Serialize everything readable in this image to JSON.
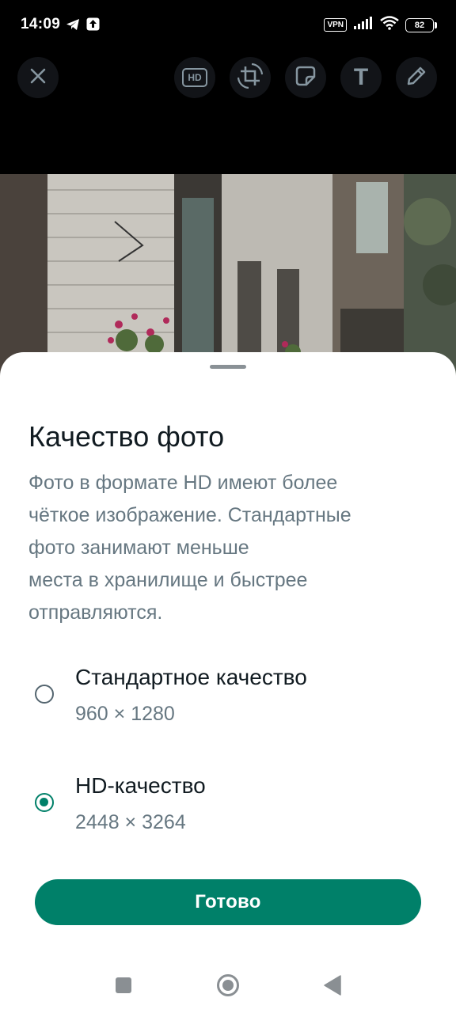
{
  "status_bar": {
    "time": "14:09",
    "vpn": "VPN",
    "battery": "82",
    "icons": [
      "telegram-icon",
      "upload-notification-icon",
      "signal-icon",
      "wifi-icon",
      "battery-icon"
    ]
  },
  "toolbar": {
    "icons": [
      "close-icon",
      "hd-icon",
      "crop-rotate-icon",
      "sticker-icon",
      "text-icon",
      "pencil-icon"
    ],
    "hd_label": "HD",
    "text_tool_label": "T"
  },
  "sheet": {
    "title": "Качество фото",
    "description": "Фото в формате HD имеют более\nчёткое изображение. Стандартные\nфото занимают меньше\nместа в хранилище и быстрее\nотправляются.",
    "options": [
      {
        "label": "Стандартное качество",
        "resolution": "960 × 1280",
        "selected": false
      },
      {
        "label": "HD-качество",
        "resolution": "2448 × 3264",
        "selected": true
      }
    ],
    "done_label": "Готово"
  },
  "navbar": {
    "icons": [
      "recents-square-icon",
      "home-circle-icon",
      "back-triangle-icon"
    ]
  },
  "colors": {
    "accent": "#008069",
    "title_text": "#111b21",
    "secondary_text": "#667781"
  }
}
